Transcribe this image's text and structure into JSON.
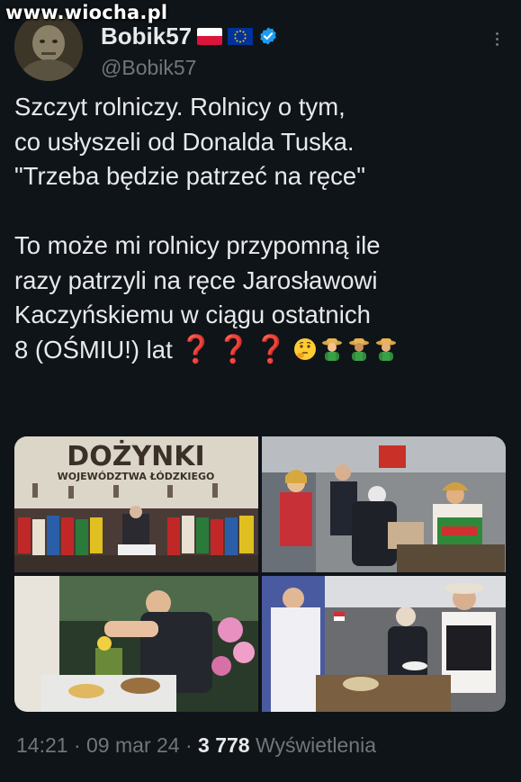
{
  "watermark": {
    "text": "www.wiocha.pl"
  },
  "author": {
    "display_name": "Bobik57",
    "handle": "@Bobik57",
    "verified": true,
    "flags": [
      "poland-flag",
      "eu-flag"
    ]
  },
  "tweet": {
    "lines_1": [
      "Szczyt rolniczy. Rolnicy o tym,",
      "co usłyszeli od Donalda Tuska.",
      "\"Trzeba będzie patrzeć na ręce\""
    ],
    "lines_2": [
      "To może mi rolnicy przypomną ile",
      "razy patrzyli na ręce Jarosławowi",
      "Kaczyńskiemu w ciągu ostatnich"
    ],
    "last_line": "8 (OŚMIU!) lat",
    "emojis": [
      "question-mark-icon",
      "question-mark-icon",
      "question-mark-icon",
      "thinking-face-icon",
      "farmer-icon",
      "farmer-icon",
      "farmer-icon"
    ],
    "question_marks": "❓❓❓"
  },
  "media": {
    "photo1_banner_title": "DOŻYNKI",
    "photo1_banner_subtitle": "WOJEWÓDZTWA ŁÓDZKIEGO"
  },
  "meta": {
    "time": "14:21",
    "sep1": "·",
    "date": "09 mar 24",
    "sep2": "·",
    "views_count": "3 778",
    "views_label": "Wyświetlenia"
  },
  "colors": {
    "background": "#0f1419",
    "text": "#e7e9ea",
    "secondary": "#71767b",
    "verified": "#1d9bf0"
  }
}
